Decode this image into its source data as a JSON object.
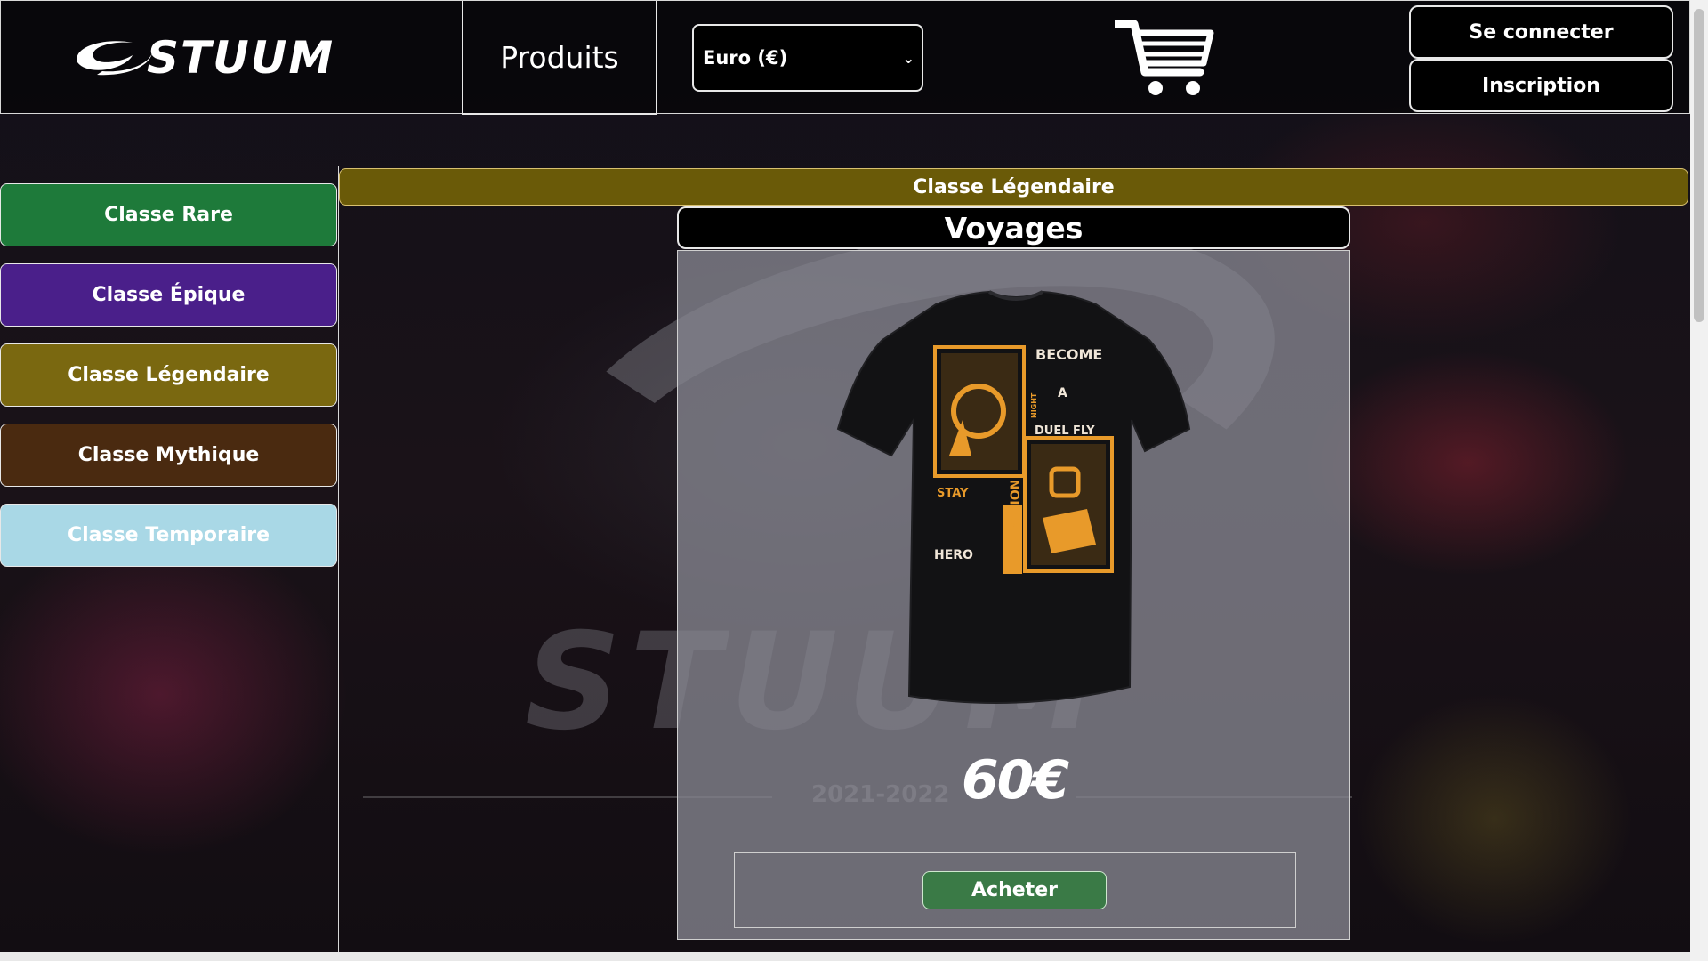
{
  "header": {
    "logo_text": "STUUM",
    "products_label": "Produits",
    "currency_selected": "Euro (€)",
    "cart_icon": "shopping-cart-icon",
    "login_label": "Se connecter",
    "signup_label": "Inscription"
  },
  "sidebar": {
    "items": [
      {
        "label": "Classe Rare",
        "color": "#1e7a3a"
      },
      {
        "label": "Classe Épique",
        "color": "#4a1f8a"
      },
      {
        "label": "Classe Légendaire",
        "color": "#7a6810"
      },
      {
        "label": "Classe Mythique",
        "color": "#4a2a10"
      },
      {
        "label": "Classe Temporaire",
        "color": "#a9d8e6"
      }
    ]
  },
  "main": {
    "category_title": "Classe Légendaire",
    "product_name": "Voyages",
    "price": "60€",
    "buy_label": "Acheter",
    "product_image": {
      "words": [
        "BECOME",
        "A",
        "NIGHT",
        "DUEL FLY",
        "STAY",
        "HERO",
        "INSPIRATION"
      ]
    }
  },
  "background": {
    "word": "STUUM",
    "years": "2021-2022"
  },
  "colors": {
    "category_bar": "#6a5a08",
    "buy_button": "#3a7a46",
    "tshirt_print": "#e89a2a"
  }
}
